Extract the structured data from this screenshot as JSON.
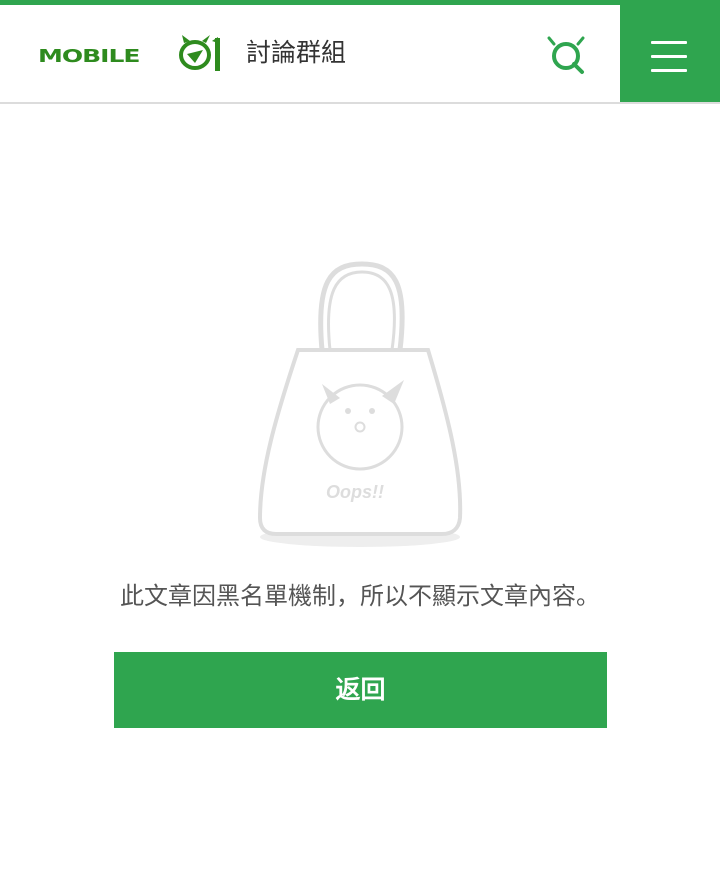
{
  "header": {
    "logo_text": "MOBILE01",
    "section_title": "討論群組",
    "search_icon": "search-icon",
    "menu_icon": "hamburger-menu-icon"
  },
  "main": {
    "illustration_label": "Oops!!",
    "message": "此文章因黑名單機制，所以不顯示文章內容。",
    "back_button_label": "返回"
  },
  "colors": {
    "brand_green": "#2fa54f",
    "logo_green": "#2e8b1e",
    "illustration_gray": "#dddddd"
  }
}
